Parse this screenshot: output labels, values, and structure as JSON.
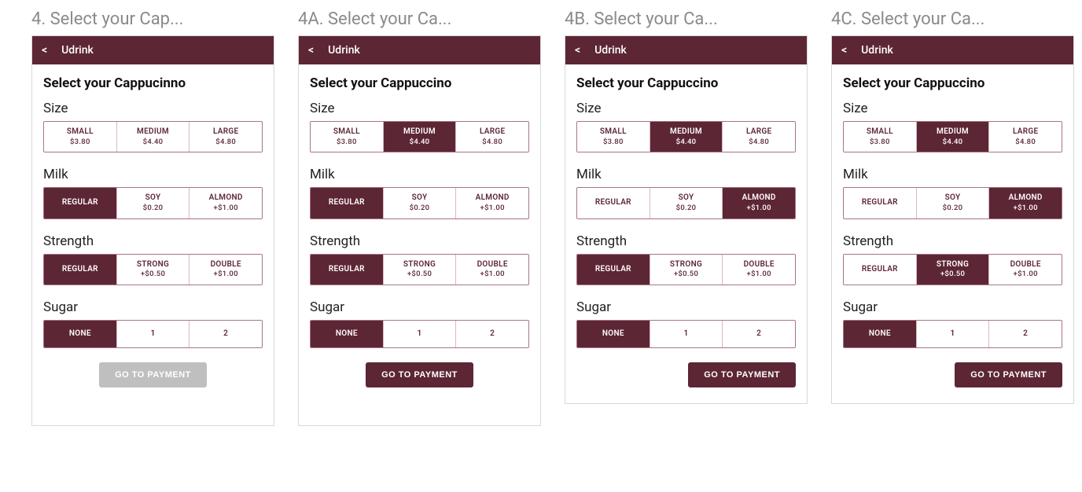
{
  "screens": [
    {
      "frame_title": "4. Select your Cap...",
      "app_name": "Udrink",
      "page_title": "Select your Cappucinno",
      "sections": {
        "size": {
          "label": "Size",
          "options": [
            {
              "l1": "SMALL",
              "l2": "$3.80",
              "sel": false
            },
            {
              "l1": "MEDIUM",
              "l2": "$4.40",
              "sel": false
            },
            {
              "l1": "LARGE",
              "l2": "$4.80",
              "sel": false
            }
          ]
        },
        "milk": {
          "label": "Milk",
          "options": [
            {
              "l1": "REGULAR",
              "l2": "",
              "sel": true
            },
            {
              "l1": "SOY",
              "l2": "$0.20",
              "sel": false
            },
            {
              "l1": "ALMOND",
              "l2": "+$1.00",
              "sel": false
            }
          ]
        },
        "strength": {
          "label": "Strength",
          "options": [
            {
              "l1": "REGULAR",
              "l2": "",
              "sel": true
            },
            {
              "l1": "STRONG",
              "l2": "+$0.50",
              "sel": false
            },
            {
              "l1": "DOUBLE",
              "l2": "+$1.00",
              "sel": false
            }
          ]
        },
        "sugar": {
          "label": "Sugar",
          "options": [
            {
              "l1": "NONE",
              "l2": "",
              "sel": true
            },
            {
              "l1": "1",
              "l2": "",
              "sel": false
            },
            {
              "l1": "2",
              "l2": "",
              "sel": false
            }
          ]
        }
      },
      "cta": {
        "label": "GO TO PAYMENT",
        "enabled": false
      },
      "cta_align": "center",
      "extra_pad": true
    },
    {
      "frame_title": "4A. Select your Ca...",
      "app_name": "Udrink",
      "page_title": "Select your Cappuccino",
      "sections": {
        "size": {
          "label": "Size",
          "options": [
            {
              "l1": "SMALL",
              "l2": "$3.80",
              "sel": false
            },
            {
              "l1": "MEDIUM",
              "l2": "$4.40",
              "sel": true
            },
            {
              "l1": "LARGE",
              "l2": "$4.80",
              "sel": false
            }
          ]
        },
        "milk": {
          "label": "Milk",
          "options": [
            {
              "l1": "REGULAR",
              "l2": "",
              "sel": true
            },
            {
              "l1": "SOY",
              "l2": "$0.20",
              "sel": false
            },
            {
              "l1": "ALMOND",
              "l2": "+$1.00",
              "sel": false
            }
          ]
        },
        "strength": {
          "label": "Strength",
          "options": [
            {
              "l1": "REGULAR",
              "l2": "",
              "sel": true
            },
            {
              "l1": "STRONG",
              "l2": "+$0.50",
              "sel": false
            },
            {
              "l1": "DOUBLE",
              "l2": "+$1.00",
              "sel": false
            }
          ]
        },
        "sugar": {
          "label": "Sugar",
          "options": [
            {
              "l1": "NONE",
              "l2": "",
              "sel": true
            },
            {
              "l1": "1",
              "l2": "",
              "sel": false
            },
            {
              "l1": "2",
              "l2": "",
              "sel": false
            }
          ]
        }
      },
      "cta": {
        "label": "GO TO PAYMENT",
        "enabled": true
      },
      "cta_align": "center",
      "extra_pad": true
    },
    {
      "frame_title": "4B. Select your Ca...",
      "app_name": "Udrink",
      "page_title": "Select your Cappuccino",
      "sections": {
        "size": {
          "label": "Size",
          "options": [
            {
              "l1": "SMALL",
              "l2": "$3.80",
              "sel": false
            },
            {
              "l1": "MEDIUM",
              "l2": "$4.40",
              "sel": true
            },
            {
              "l1": "LARGE",
              "l2": "$4.80",
              "sel": false
            }
          ]
        },
        "milk": {
          "label": "Milk",
          "options": [
            {
              "l1": "REGULAR",
              "l2": "",
              "sel": false
            },
            {
              "l1": "SOY",
              "l2": "$0.20",
              "sel": false
            },
            {
              "l1": "ALMOND",
              "l2": "+$1.00",
              "sel": true
            }
          ]
        },
        "strength": {
          "label": "Strength",
          "options": [
            {
              "l1": "REGULAR",
              "l2": "",
              "sel": true
            },
            {
              "l1": "STRONG",
              "l2": "+$0.50",
              "sel": false
            },
            {
              "l1": "DOUBLE",
              "l2": "+$1.00",
              "sel": false
            }
          ]
        },
        "sugar": {
          "label": "Sugar",
          "options": [
            {
              "l1": "NONE",
              "l2": "",
              "sel": true
            },
            {
              "l1": "1",
              "l2": "",
              "sel": false
            },
            {
              "l1": "2",
              "l2": "",
              "sel": false
            }
          ]
        }
      },
      "cta": {
        "label": "GO TO PAYMENT",
        "enabled": true
      },
      "cta_align": "right",
      "extra_pad": false
    },
    {
      "frame_title": "4C. Select your Ca...",
      "app_name": "Udrink",
      "page_title": "Select your Cappuccino",
      "sections": {
        "size": {
          "label": "Size",
          "options": [
            {
              "l1": "SMALL",
              "l2": "$3.80",
              "sel": false
            },
            {
              "l1": "MEDIUM",
              "l2": "$4.40",
              "sel": true
            },
            {
              "l1": "LARGE",
              "l2": "$4.80",
              "sel": false
            }
          ]
        },
        "milk": {
          "label": "Milk",
          "options": [
            {
              "l1": "REGULAR",
              "l2": "",
              "sel": false
            },
            {
              "l1": "SOY",
              "l2": "$0.20",
              "sel": false
            },
            {
              "l1": "ALMOND",
              "l2": "+$1.00",
              "sel": true
            }
          ]
        },
        "strength": {
          "label": "Strength",
          "options": [
            {
              "l1": "REGULAR",
              "l2": "",
              "sel": false
            },
            {
              "l1": "STRONG",
              "l2": "+$0.50",
              "sel": true
            },
            {
              "l1": "DOUBLE",
              "l2": "+$1.00",
              "sel": false
            }
          ]
        },
        "sugar": {
          "label": "Sugar",
          "options": [
            {
              "l1": "NONE",
              "l2": "",
              "sel": true
            },
            {
              "l1": "1",
              "l2": "",
              "sel": false
            },
            {
              "l1": "2",
              "l2": "",
              "sel": false
            }
          ]
        }
      },
      "cta": {
        "label": "GO TO PAYMENT",
        "enabled": true
      },
      "cta_align": "right",
      "extra_pad": false
    }
  ]
}
